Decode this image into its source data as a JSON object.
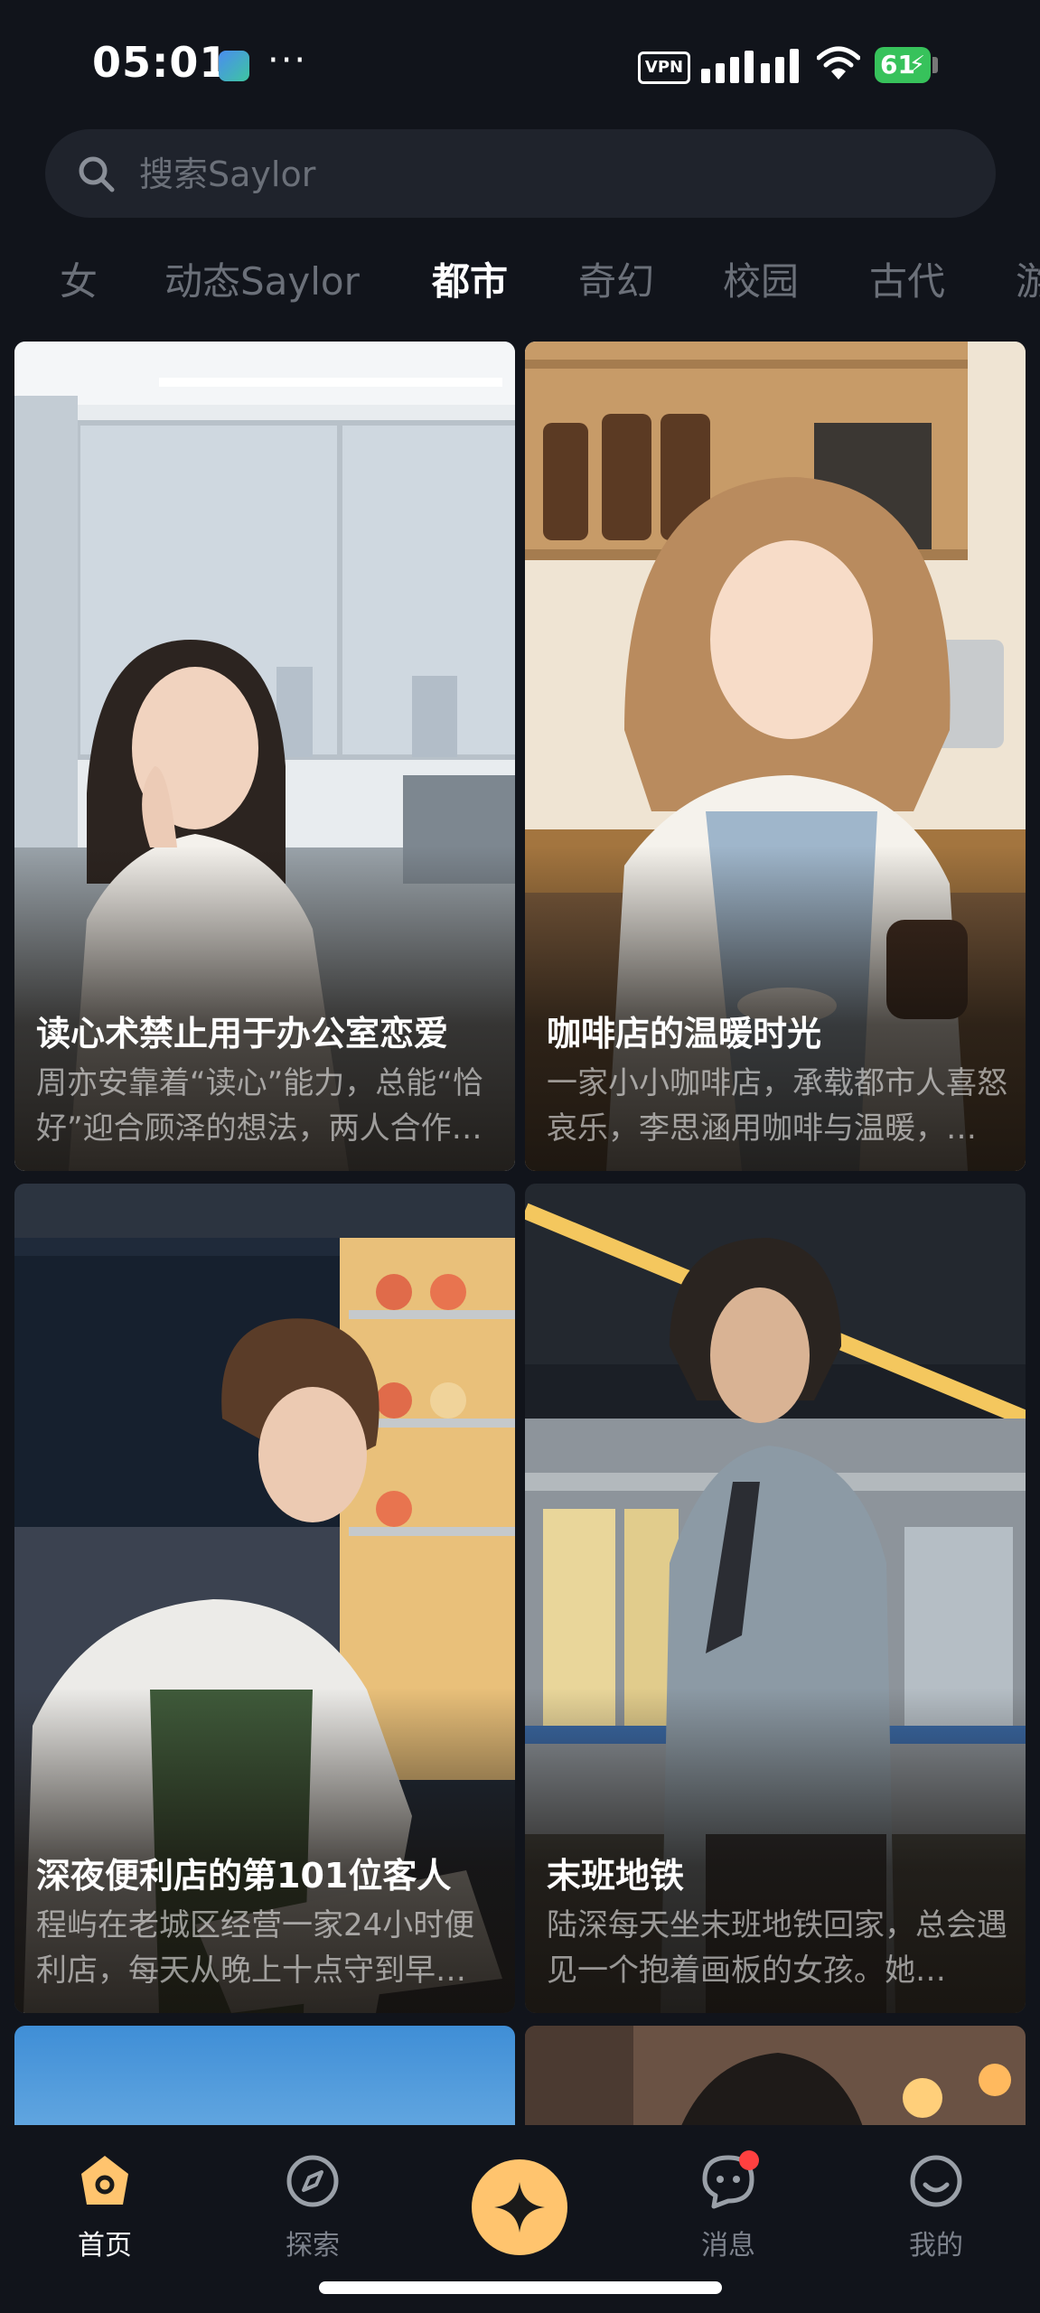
{
  "status_bar": {
    "time": "05:01",
    "vpn": "VPN",
    "battery": "61"
  },
  "search": {
    "placeholder": "搜索Saylor"
  },
  "tabs": [
    "女",
    "动态Saylor",
    "都市",
    "奇幻",
    "校园",
    "古代",
    "游"
  ],
  "active_tab": "都市",
  "cards": [
    {
      "title": "读心术禁止用于办公室恋爱",
      "desc": "周亦安靠着“读心”能力，总能“恰好”迎合顾泽的想法，两人合作…"
    },
    {
      "title": "咖啡店的温暖时光",
      "desc": "一家小小咖啡店，承载都市人喜怒哀乐，李思涵用咖啡与温暖，…"
    },
    {
      "title": "深夜便利店的第101位客人",
      "desc": "程屿在老城区经营一家24小时便利店，每天从晚上十点守到早…"
    },
    {
      "title": "末班地铁",
      "desc": "陆深每天坐末班地铁回家，总会遇见一个抱着画板的女孩。她…"
    }
  ],
  "nav": [
    {
      "label": "首页",
      "icon": "home-icon"
    },
    {
      "label": "探索",
      "icon": "compass-icon"
    },
    {
      "label": "",
      "icon": "sparkle-icon"
    },
    {
      "label": "消息",
      "icon": "message-icon"
    },
    {
      "label": "我的",
      "icon": "profile-icon"
    }
  ],
  "colors": {
    "accent": "#ffc46e",
    "background": "#11141b",
    "badge": "#ff4040"
  }
}
